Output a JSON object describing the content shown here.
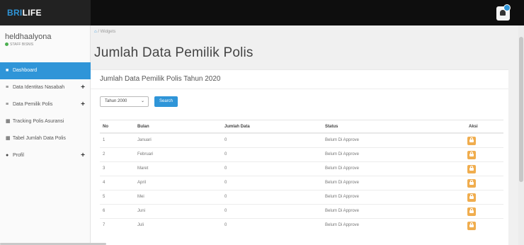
{
  "app": {
    "brand_prefix": "BRI",
    "brand_suffix": "LIFE",
    "accent": "#2f95d8"
  },
  "user": {
    "name": "heldhaalyona",
    "role": "STAFF BISNIS"
  },
  "sidebar": {
    "items": [
      {
        "label": "Dashboard",
        "icon": "dashboard-icon",
        "active": true,
        "expandable": false
      },
      {
        "label": "Data Identitas Nasabah",
        "icon": "list-icon",
        "active": false,
        "expandable": true
      },
      {
        "label": "Data Pemilik Polis",
        "icon": "list-icon",
        "active": false,
        "expandable": true
      },
      {
        "label": "Tracking Polis Asuransi",
        "icon": "calendar-icon",
        "active": false,
        "expandable": false
      },
      {
        "label": "Tabel Jumlah Data Polis",
        "icon": "calendar-icon",
        "active": false,
        "expandable": false
      },
      {
        "label": "Profil",
        "icon": "user-icon",
        "active": false,
        "expandable": true
      }
    ]
  },
  "breadcrumb": {
    "current": "Widgets"
  },
  "page": {
    "title": "Jumlah Data Pemilik Polis"
  },
  "panel": {
    "title": "Jumlah Data Pemilik Polis Tahun 2020",
    "year_select": "Tahun 2000",
    "search_label": "Search"
  },
  "table": {
    "headers": {
      "no": "No",
      "bulan": "Bulan",
      "jumlah": "Jumlah Data",
      "status": "Status",
      "aksi": "Aksi"
    },
    "rows": [
      {
        "no": "1",
        "bulan": "Januari",
        "jumlah": "0",
        "status": "Belum Di Approve"
      },
      {
        "no": "2",
        "bulan": "Februari",
        "jumlah": "0",
        "status": "Belum Di Approve"
      },
      {
        "no": "3",
        "bulan": "Maret",
        "jumlah": "0",
        "status": "Belum Di Approve"
      },
      {
        "no": "4",
        "bulan": "April",
        "jumlah": "0",
        "status": "Belum Di Approve"
      },
      {
        "no": "5",
        "bulan": "Mei",
        "jumlah": "0",
        "status": "Belum Di Approve"
      },
      {
        "no": "6",
        "bulan": "Juni",
        "jumlah": "0",
        "status": "Belum Di Approve"
      },
      {
        "no": "7",
        "bulan": "Juli",
        "jumlah": "0",
        "status": "Belum Di Approve"
      }
    ]
  }
}
